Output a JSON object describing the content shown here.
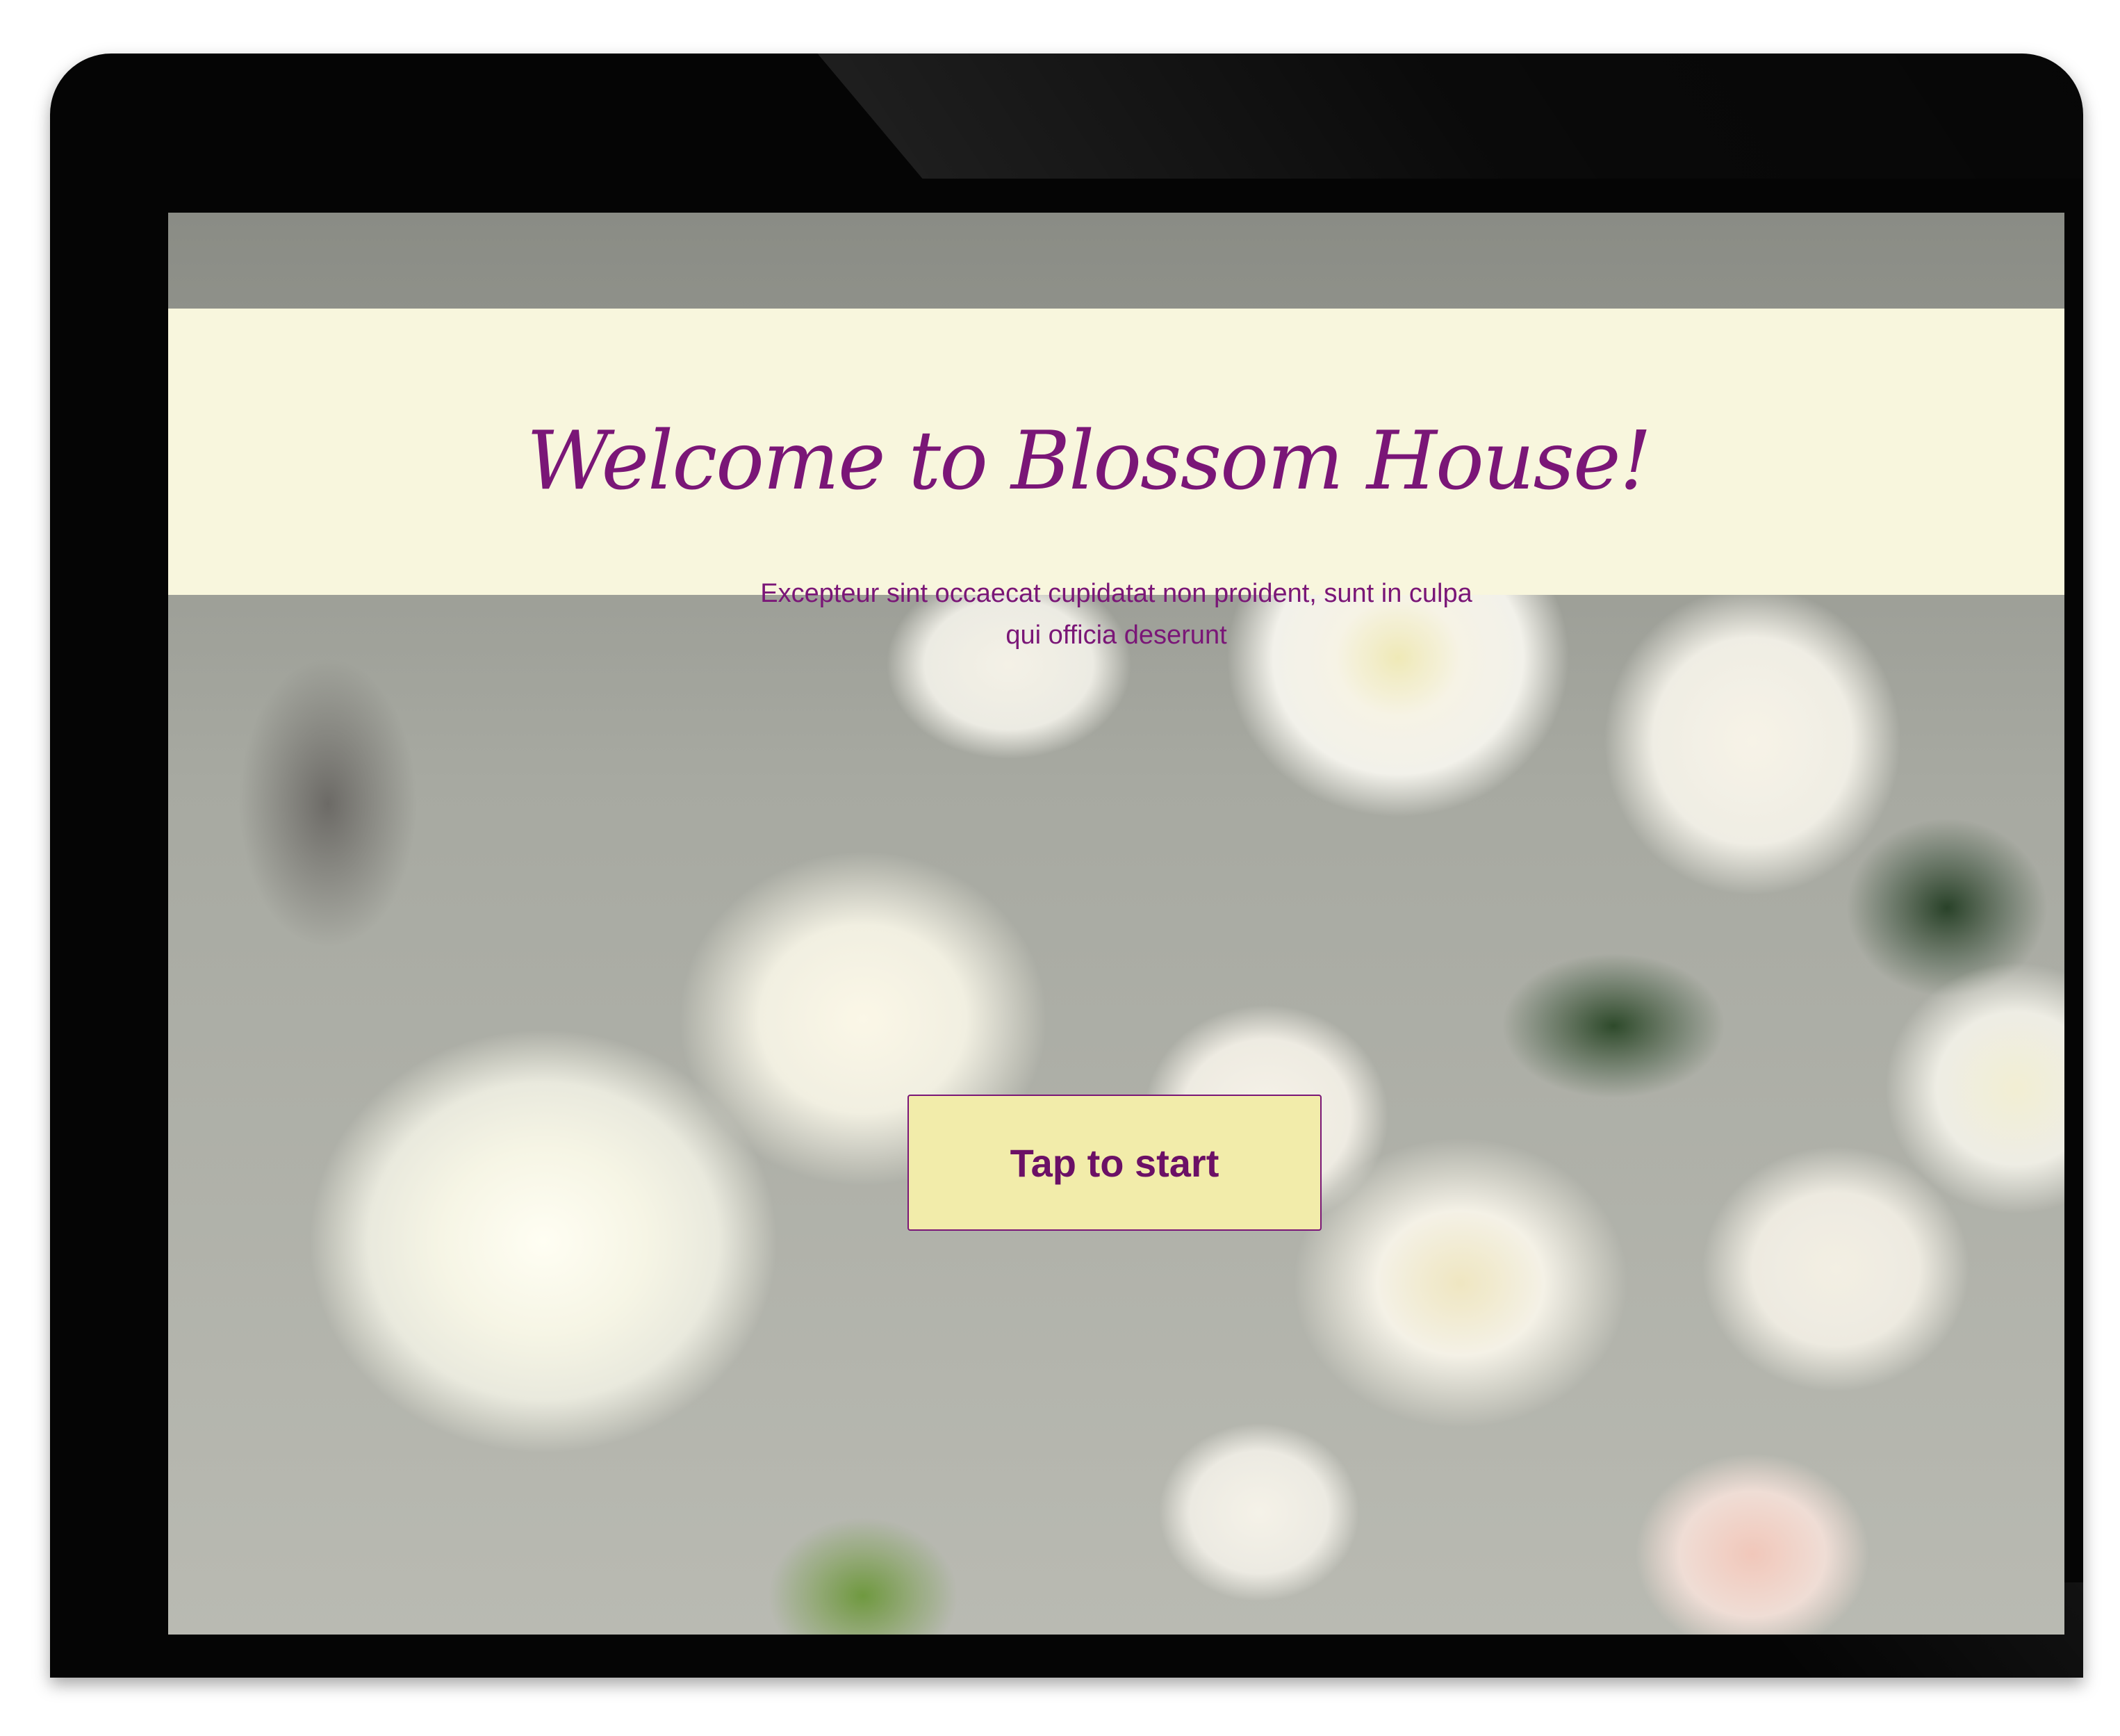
{
  "app": {
    "title": "Welcome to Blossom House!",
    "subtitle": "Excepteur sint occaecat cupidatat non proident, sunt in culpa qui officia deserunt"
  },
  "actions": {
    "start_label": "Tap to start"
  },
  "colors": {
    "accent": "#7a1677",
    "header_background": "#f8f6dd",
    "button_background": "#f2ecaa",
    "device_frame": "#050505"
  },
  "background_image": {
    "description_icon": "white-roses-photo"
  }
}
